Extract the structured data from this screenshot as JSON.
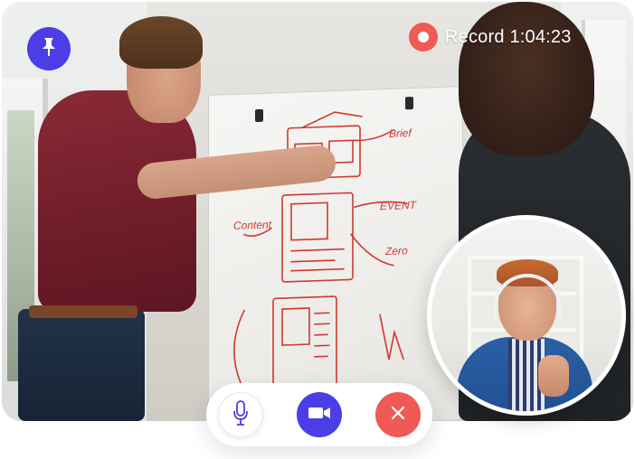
{
  "record": {
    "label": "Record",
    "elapsed": "1:04:23",
    "indicator_color": "#ef5a55"
  },
  "icons": {
    "pin": "pin-icon",
    "record": "record-dot-icon",
    "microphone": "microphone-icon",
    "camera": "video-camera-icon",
    "end_call": "close-icon"
  },
  "colors": {
    "primary": "#4b3ee6",
    "danger": "#ef5a55",
    "surface": "#ffffff"
  }
}
